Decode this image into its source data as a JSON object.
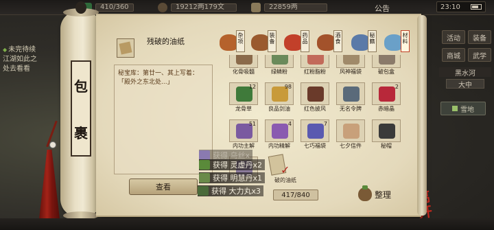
{
  "topbar": {
    "stamina": "410/360",
    "money": "19212两179文",
    "silver": "22859两",
    "announce": "公告",
    "clock": "23:10",
    "colors": {
      "stamina": "#2f6a3a",
      "money": "#5a4a36",
      "silver": "#8a7a5a"
    }
  },
  "quest": {
    "title": "未完待续",
    "body": "江湖如此之",
    "hint": "处去看看"
  },
  "right_panel": {
    "buttons": [
      "活动",
      "装备",
      "商城",
      "武学",
      "传书",
      "秘籍"
    ],
    "location": "黑水河",
    "sub_location": "大中",
    "map_node": "雪地",
    "leave": "离开"
  },
  "bag": {
    "title_chars": [
      "包",
      "裹"
    ],
    "selected_item": {
      "name": "残破的油纸",
      "desc_line1": "秘宝库：第廿一、其上写着：",
      "desc_line2": "「殿外之东北处...」"
    },
    "view_button": "查看",
    "capacity": "417/840",
    "sort_button": "整理",
    "tabs": [
      {
        "label": "杂项",
        "icon": "sundries-icon",
        "color": "#b5622c"
      },
      {
        "label": "装备",
        "icon": "equipment-icon",
        "color": "#9a5a2e"
      },
      {
        "label": "药品",
        "icon": "medicine-icon",
        "color": "#c2402a"
      },
      {
        "label": "酒食",
        "icon": "food-icon",
        "color": "#a3522b"
      },
      {
        "label": "秘籍",
        "icon": "manual-icon",
        "color": "#5a7aa8"
      },
      {
        "label": "材料",
        "icon": "material-icon",
        "color": "#6aa0c8"
      }
    ],
    "items": [
      {
        "name": "化骨吸髓",
        "count": "",
        "color": "#8a6a4a"
      },
      {
        "name": "绿鳞粉",
        "count": "",
        "color": "#6a8a5a"
      },
      {
        "name": "红粉脂粉",
        "count": "",
        "color": "#c26a5a"
      },
      {
        "name": "风神福袋",
        "count": "",
        "color": "#a08a6a"
      },
      {
        "name": "破包盒",
        "count": "",
        "color": "#8a7a6a"
      },
      {
        "name": "龙骨草",
        "count": "12",
        "color": "#3f7a3a"
      },
      {
        "name": "良品剑油",
        "count": "98",
        "color": "#c89a3a"
      },
      {
        "name": "红色披风",
        "count": "",
        "color": "#6a3a2a"
      },
      {
        "name": "无名令牌",
        "count": "",
        "color": "#5a6a7a"
      },
      {
        "name": "赤暗晶",
        "count": "2",
        "color": "#b8283a"
      },
      {
        "name": "内功主解",
        "count": "51",
        "color": "#7a5aa0"
      },
      {
        "name": "内功精解",
        "count": "4",
        "color": "#8a5ab0"
      },
      {
        "name": "七巧福袋",
        "count": "7",
        "color": "#5a5ab0"
      },
      {
        "name": "七夕信件",
        "count": "",
        "color": "#c8a07a"
      },
      {
        "name": "秘帽",
        "count": "",
        "color": "#3a3a3a"
      },
      {
        "name": "",
        "count": "",
        "color": "#8a7a9a"
      }
    ]
  },
  "notifications": [
    {
      "text": "获得 乌丝x",
      "faded": true,
      "icon_color": "#8a7ab0"
    },
    {
      "text": "获得 灵虚丹x2",
      "faded": false,
      "icon_color": "#5a8a3a"
    },
    {
      "text": "获得 明慧丹x1",
      "faded": false,
      "icon_color": "#6a8a4a"
    },
    {
      "text": "获得 大力丸x3",
      "faded": false,
      "icon_color": "#4a6a3a"
    }
  ],
  "notif_small": "破的油纸"
}
